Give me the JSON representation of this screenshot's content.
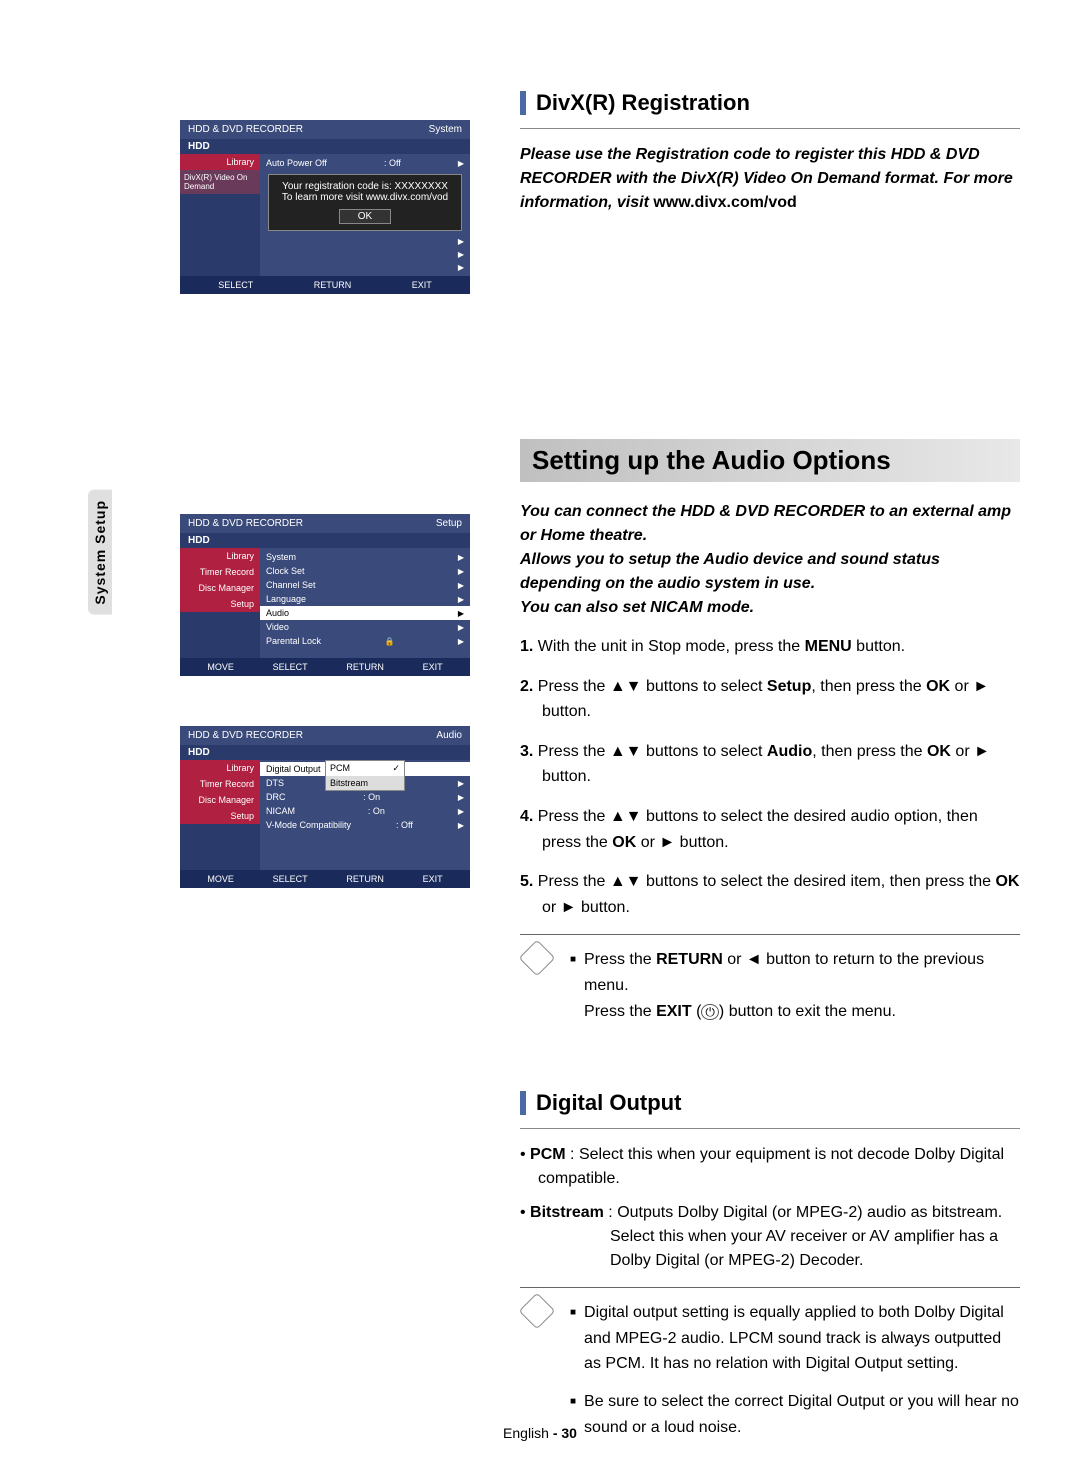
{
  "sideTab": "System Setup",
  "footer": {
    "lang": "English",
    "page": "- 30"
  },
  "osd1": {
    "title": "HDD & DVD RECORDER",
    "corner": "System",
    "hdd": "HDD",
    "sidebar": [
      "Library",
      "DivX(R) Video On Demand"
    ],
    "row": {
      "label": "Auto Power Off",
      "value": ": Off"
    },
    "dialogLine1": "Your registration code is: XXXXXXXX",
    "dialogLine2": "To learn more visit www.divx.com/vod",
    "ok": "OK",
    "footer": {
      "select": "SELECT",
      "return": "RETURN",
      "exit": "EXIT"
    }
  },
  "osd2": {
    "title": "HDD & DVD RECORDER",
    "corner": "Setup",
    "hdd": "HDD",
    "sidebar": [
      "Library",
      "Timer Record",
      "Disc Manager",
      "Setup"
    ],
    "items": [
      "System",
      "Clock Set",
      "Channel Set",
      "Language",
      "Audio",
      "Video",
      "Parental Lock"
    ],
    "selected": "Audio",
    "footer": {
      "move": "MOVE",
      "select": "SELECT",
      "return": "RETURN",
      "exit": "EXIT"
    }
  },
  "osd3": {
    "title": "HDD & DVD RECORDER",
    "corner": "Audio",
    "hdd": "HDD",
    "sidebar": [
      "Library",
      "Timer Record",
      "Disc Manager",
      "Setup"
    ],
    "items": [
      {
        "label": "Digital Output",
        "value": ""
      },
      {
        "label": "DTS",
        "value": ""
      },
      {
        "label": "DRC",
        "value": ": On"
      },
      {
        "label": "NICAM",
        "value": ": On"
      },
      {
        "label": "V-Mode Compatibility",
        "value": ": Off"
      }
    ],
    "popup": [
      {
        "label": "PCM",
        "check": "✓"
      },
      {
        "label": "Bitstream",
        "check": ""
      }
    ],
    "footer": {
      "move": "MOVE",
      "select": "SELECT",
      "return": "RETURN",
      "exit": "EXIT"
    }
  },
  "divx": {
    "heading": "DivX(R) Registration",
    "introBold": "Please use the Registration code to register this HDD & DVD RECORDER with the DivX(R) Video On Demand format. For more information, visit",
    "introTail": " www.divx.com/vod"
  },
  "audio": {
    "title": "Setting up the Audio Options",
    "intro1": "You can connect the HDD & DVD RECORDER to an external amp or Home theatre.",
    "intro2": "Allows you to setup the Audio device and sound status depending on the audio system in use.",
    "intro3": "You can also set NICAM mode.",
    "step1a": "1.",
    "step1b": "With the unit in Stop mode, press the ",
    "step1c": "MENU",
    "step1d": " button.",
    "step2a": "2.",
    "step2b": "Press the ▲▼ buttons to select ",
    "step2c": "Setup",
    "step2d": ", then press the ",
    "step2e": "OK",
    "step2f": " or ► button.",
    "step3a": "3.",
    "step3b": "Press the ▲▼ buttons to select ",
    "step3c": "Audio",
    "step3d": ", then press the ",
    "step3e": "OK",
    "step3f": " or ► button.",
    "step4a": "4.",
    "step4b": "Press the ▲▼ buttons to select the desired audio option, then press the ",
    "step4c": "OK",
    "step4d": " or ► button.",
    "step5a": "5.",
    "step5b": "Press the ▲▼ buttons to select the desired item, then press the ",
    "step5c": "OK",
    "step5d": " or ► button.",
    "note1a": "Press the ",
    "note1b": "RETURN",
    "note1c": " or ◄ button to return to the previous menu.",
    "note2a": "Press the ",
    "note2b": "EXIT",
    "note2c": " (",
    "note2d": ") button to exit the menu."
  },
  "digital": {
    "heading": "Digital Output",
    "b1a": "• ",
    "b1b": "PCM",
    "b1c": " : Select this when your equipment is not decode Dolby Digital compatible.",
    "b2a": "• ",
    "b2b": "Bitstream",
    "b2c": " : Outputs Dolby Digital (or MPEG-2) audio as bitstream.",
    "b2d": "Select this when your AV receiver or AV amplifier has a Dolby Digital (or MPEG-2) Decoder.",
    "note1": "Digital output setting is equally applied to both Dolby Digital and MPEG-2 audio. LPCM sound track is always outputted as PCM. It has no relation with Digital Output setting.",
    "note2": "Be sure to select the correct Digital Output or you will hear no sound or a loud noise."
  }
}
